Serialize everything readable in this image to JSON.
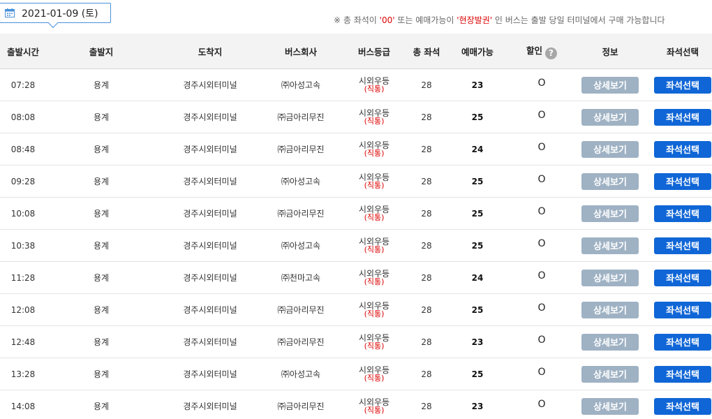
{
  "date": {
    "value": "2021-01-09 (토)",
    "icon": "calendar-icon"
  },
  "notice": {
    "prefix": "※ 총 좌석이 ",
    "zero": "'00'",
    "mid": " 또는 예매가능이 ",
    "onsite": "'현장발권'",
    "suffix": " 인 버스는 출발 당일 터미널에서 구매 가능합니다"
  },
  "headers": {
    "depart_time": "출발시간",
    "origin": "출발지",
    "destination": "도착지",
    "company": "버스회사",
    "grade": "버스등급",
    "total_seats": "총 좌석",
    "available": "예매가능",
    "discount": "할인",
    "discount_help": "?",
    "info": "정보",
    "seat_select": "좌석선택"
  },
  "buttons": {
    "detail": "상세보기",
    "seat": "좌석선택"
  },
  "rows": [
    {
      "time": "07:28",
      "origin": "용계",
      "dest": "경주시외터미널",
      "company": "㈜아성고속",
      "grade": "시외우등",
      "grade_sub": "(직통)",
      "total": "28",
      "avail": "23",
      "discount": "O"
    },
    {
      "time": "08:08",
      "origin": "용계",
      "dest": "경주시외터미널",
      "company": "㈜금아리무진",
      "grade": "시외우등",
      "grade_sub": "(직통)",
      "total": "28",
      "avail": "25",
      "discount": "O"
    },
    {
      "time": "08:48",
      "origin": "용계",
      "dest": "경주시외터미널",
      "company": "㈜금아리무진",
      "grade": "시외우등",
      "grade_sub": "(직통)",
      "total": "28",
      "avail": "24",
      "discount": "O"
    },
    {
      "time": "09:28",
      "origin": "용계",
      "dest": "경주시외터미널",
      "company": "㈜아성고속",
      "grade": "시외우등",
      "grade_sub": "(직통)",
      "total": "28",
      "avail": "25",
      "discount": "O"
    },
    {
      "time": "10:08",
      "origin": "용계",
      "dest": "경주시외터미널",
      "company": "㈜금아리무진",
      "grade": "시외우등",
      "grade_sub": "(직통)",
      "total": "28",
      "avail": "25",
      "discount": "O"
    },
    {
      "time": "10:38",
      "origin": "용계",
      "dest": "경주시외터미널",
      "company": "㈜아성고속",
      "grade": "시외우등",
      "grade_sub": "(직통)",
      "total": "28",
      "avail": "25",
      "discount": "O"
    },
    {
      "time": "11:28",
      "origin": "용계",
      "dest": "경주시외터미널",
      "company": "㈜천마고속",
      "grade": "시외우등",
      "grade_sub": "(직통)",
      "total": "28",
      "avail": "24",
      "discount": "O"
    },
    {
      "time": "12:08",
      "origin": "용계",
      "dest": "경주시외터미널",
      "company": "㈜금아리무진",
      "grade": "시외우등",
      "grade_sub": "(직통)",
      "total": "28",
      "avail": "25",
      "discount": "O"
    },
    {
      "time": "12:48",
      "origin": "용계",
      "dest": "경주시외터미널",
      "company": "㈜금아리무진",
      "grade": "시외우등",
      "grade_sub": "(직통)",
      "total": "28",
      "avail": "23",
      "discount": "O"
    },
    {
      "time": "13:28",
      "origin": "용계",
      "dest": "경주시외터미널",
      "company": "㈜아성고속",
      "grade": "시외우등",
      "grade_sub": "(직통)",
      "total": "28",
      "avail": "25",
      "discount": "O"
    },
    {
      "time": "14:08",
      "origin": "용계",
      "dest": "경주시외터미널",
      "company": "㈜금아리무진",
      "grade": "시외우등",
      "grade_sub": "(직통)",
      "total": "28",
      "avail": "23",
      "discount": "O"
    }
  ],
  "colors": {
    "accent": "#1066d6",
    "detail_button": "#9fb2c4",
    "highlight_red": "#dd0000",
    "header_bg": "#f3f3f3"
  }
}
